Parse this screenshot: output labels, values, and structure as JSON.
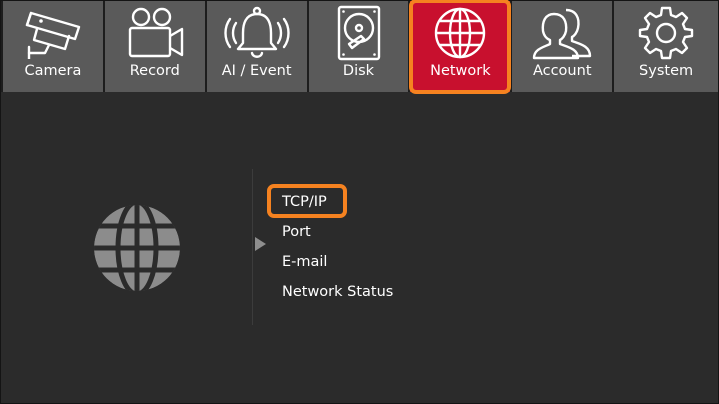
{
  "top_nav": {
    "tabs": [
      {
        "label": "Camera",
        "icon": "cctv-camera-icon"
      },
      {
        "label": "Record",
        "icon": "video-camera-icon"
      },
      {
        "label": "AI / Event",
        "icon": "alarm-bell-icon"
      },
      {
        "label": "Disk",
        "icon": "hard-disk-icon"
      },
      {
        "label": "Network",
        "icon": "globe-icon",
        "active": true
      },
      {
        "label": "Account",
        "icon": "users-icon"
      },
      {
        "label": "System",
        "icon": "gear-icon"
      }
    ]
  },
  "network_menu": {
    "section_icon": "globe-icon",
    "items": [
      {
        "label": "TCP/IP",
        "highlighted": true
      },
      {
        "label": "Port"
      },
      {
        "label": "E-mail"
      },
      {
        "label": "Network Status"
      }
    ]
  },
  "colors": {
    "background": "#2b2b2b",
    "tab_background": "#5a5a5a",
    "active_tab": "#c8102e",
    "highlight_outline": "#f58220",
    "text": "#ffffff"
  }
}
